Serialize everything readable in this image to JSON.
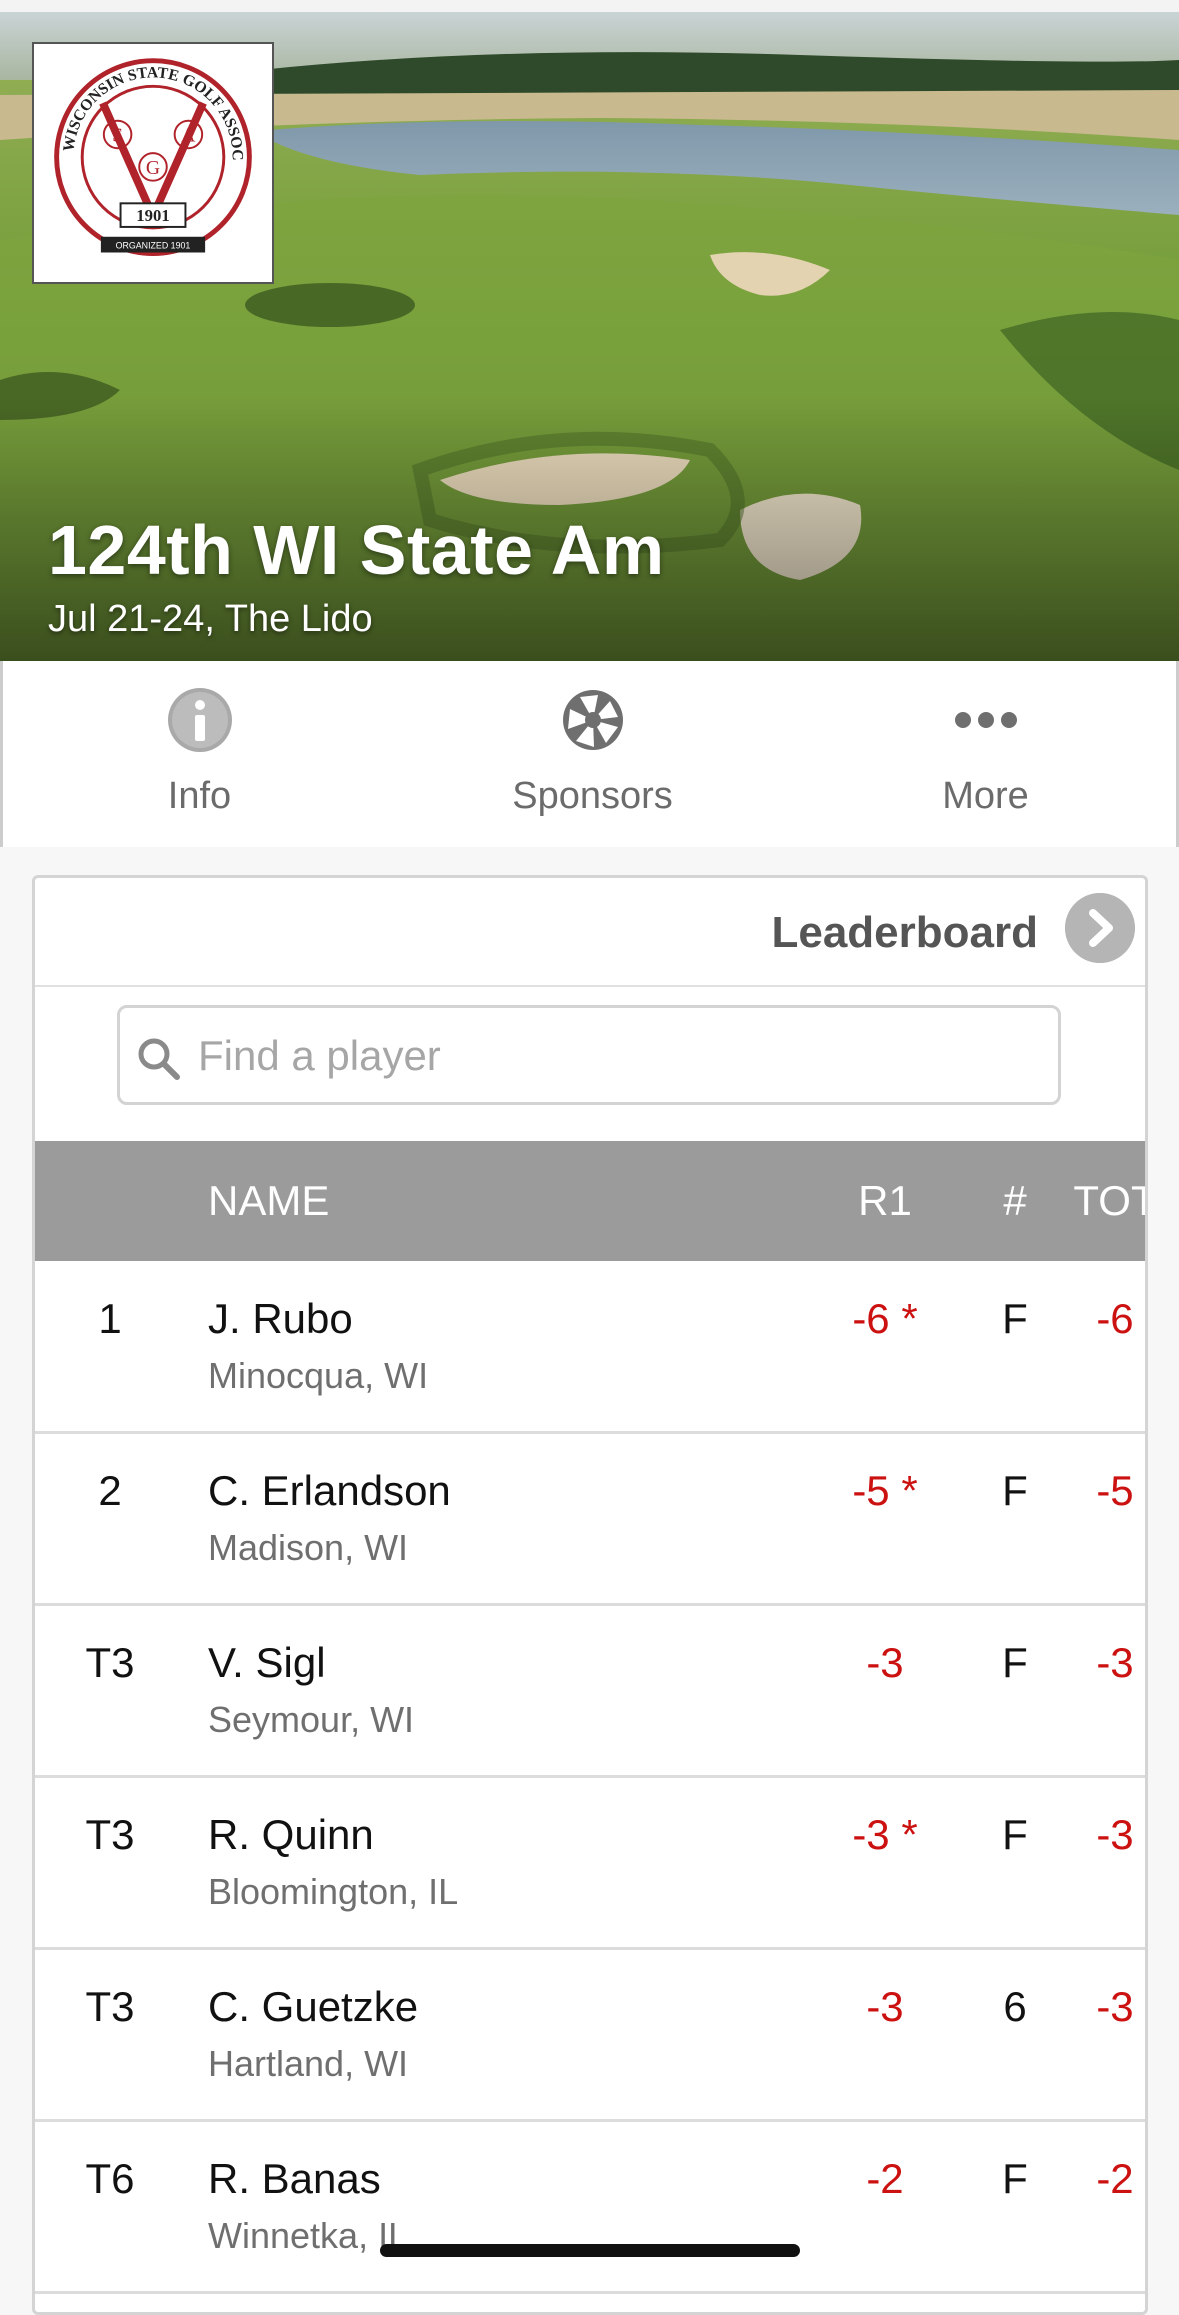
{
  "hero": {
    "title": "124th WI State Am",
    "subtitle": "Jul 21-24, The Lido",
    "logo": {
      "ring_text": "WISCONSIN STATE GOLF ASSOCIATION",
      "letters": [
        "S",
        "A",
        "G"
      ],
      "year": "1901",
      "banner": "ORGANIZED 1901"
    }
  },
  "tabs": [
    {
      "label": "Info",
      "icon": "info-icon"
    },
    {
      "label": "Sponsors",
      "icon": "aperture-icon"
    },
    {
      "label": "More",
      "icon": "ellipsis-icon"
    }
  ],
  "leaderboard": {
    "title": "Leaderboard",
    "search_placeholder": "Find a player",
    "columns": {
      "pos": "",
      "name": "NAME",
      "r1": "R1",
      "thru": "#",
      "tot": "TOT"
    },
    "rows": [
      {
        "pos": "1",
        "name": "J. Rubo",
        "location": "Minocqua, WI",
        "r1": "-6 *",
        "thru": "F",
        "tot": "-6"
      },
      {
        "pos": "2",
        "name": "C. Erlandson",
        "location": "Madison, WI",
        "r1": "-5 *",
        "thru": "F",
        "tot": "-5"
      },
      {
        "pos": "T3",
        "name": "V. Sigl",
        "location": "Seymour, WI",
        "r1": "-3",
        "thru": "F",
        "tot": "-3"
      },
      {
        "pos": "T3",
        "name": "R. Quinn",
        "location": "Bloomington, IL",
        "r1": "-3 *",
        "thru": "F",
        "tot": "-3"
      },
      {
        "pos": "T3",
        "name": "C. Guetzke",
        "location": "Hartland, WI",
        "r1": "-3",
        "thru": "6",
        "tot": "-3"
      },
      {
        "pos": "T6",
        "name": "R. Banas",
        "location": "Winnetka, IL",
        "r1": "-2",
        "thru": "F",
        "tot": "-2"
      }
    ]
  },
  "colors": {
    "score_red": "#cc1111",
    "header_gray": "#9b9b9b",
    "tab_text": "#6b6b6b"
  }
}
